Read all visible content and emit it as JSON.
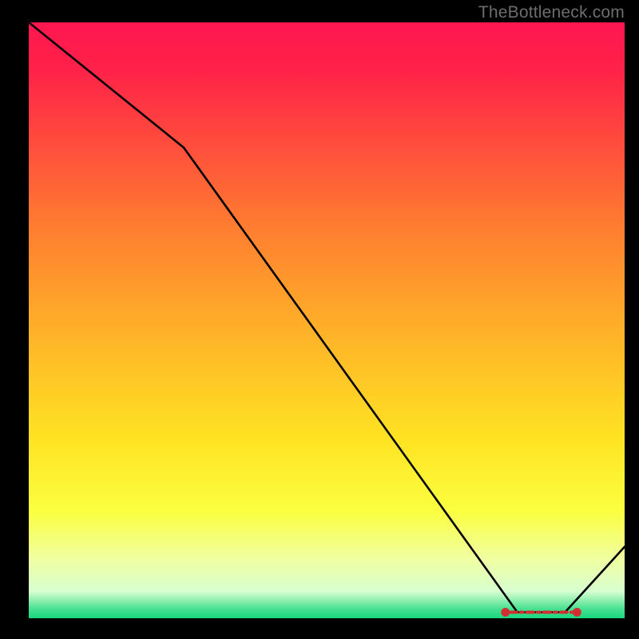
{
  "watermark": "TheBottleneck.com",
  "chart_data": {
    "type": "line",
    "title": "",
    "xlabel": "",
    "ylabel": "",
    "xlim": [
      0,
      100
    ],
    "ylim": [
      0,
      100
    ],
    "x": [
      0,
      26,
      82,
      90,
      100
    ],
    "values": [
      100,
      79,
      1,
      1,
      12
    ],
    "flat_band": {
      "x_start": 80,
      "x_end": 92,
      "y": 1
    },
    "gradient_stops": [
      {
        "pos": 0.0,
        "color": "#ff1650"
      },
      {
        "pos": 0.08,
        "color": "#ff2248"
      },
      {
        "pos": 0.35,
        "color": "#ff7f30"
      },
      {
        "pos": 0.52,
        "color": "#ffb228"
      },
      {
        "pos": 0.7,
        "color": "#ffe323"
      },
      {
        "pos": 0.82,
        "color": "#fbff3f"
      },
      {
        "pos": 0.9,
        "color": "#f0ffa0"
      },
      {
        "pos": 0.955,
        "color": "#d8ffd0"
      },
      {
        "pos": 0.985,
        "color": "#44e090"
      },
      {
        "pos": 1.0,
        "color": "#18d880"
      }
    ]
  }
}
